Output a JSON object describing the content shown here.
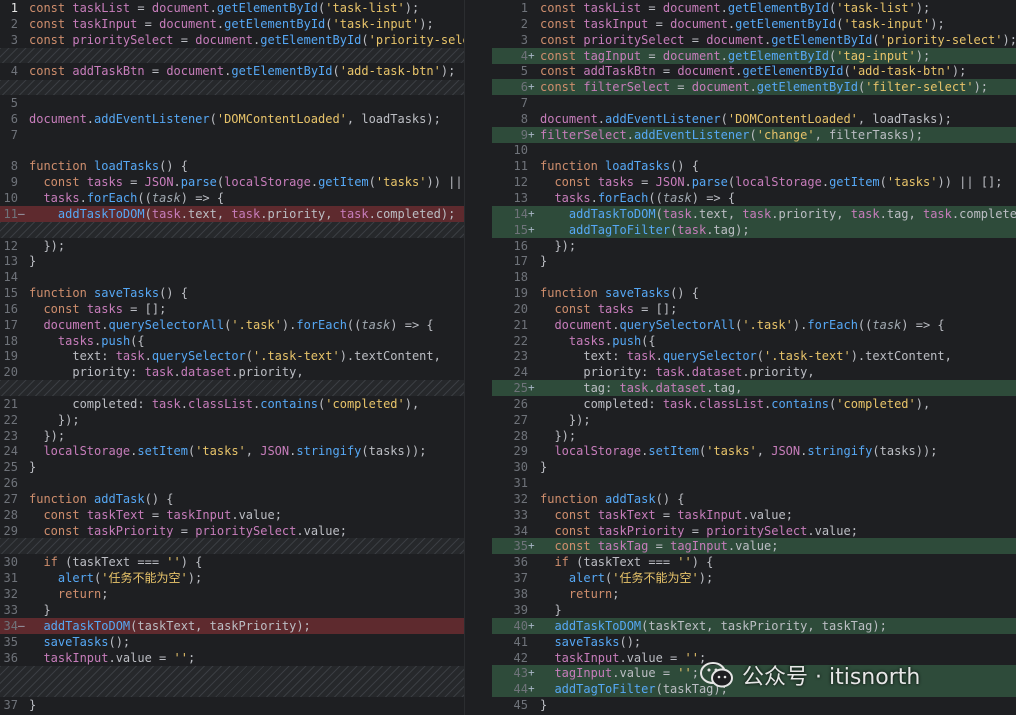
{
  "left": {
    "lines": [
      {
        "n": "1",
        "mark": "",
        "type": "cur",
        "html": "<span class=\"k\">const</span> <span class=\"v\">taskList</span> <span class=\"o\">=</span> <span class=\"v\">document</span>.<span class=\"f\">getElementById</span>(<span class=\"str\">'task-list'</span>);"
      },
      {
        "n": "2",
        "mark": "",
        "type": "",
        "html": "<span class=\"k\">const</span> <span class=\"v\">taskInput</span> <span class=\"o\">=</span> <span class=\"v\">document</span>.<span class=\"f\">getElementById</span>(<span class=\"str\">'task-input'</span>);"
      },
      {
        "n": "3",
        "mark": "",
        "type": "",
        "html": "<span class=\"k\">const</span> <span class=\"v\">prioritySelect</span> <span class=\"o\">=</span> <span class=\"v\">document</span>.<span class=\"f\">getElementById</span>(<span class=\"str\">'priority-select'</span>);"
      },
      {
        "n": "4",
        "mark": "",
        "type": "",
        "html": "<span class=\"k\">const</span> <span class=\"v\">addTaskBtn</span> <span class=\"o\">=</span> <span class=\"v\">document</span>.<span class=\"f\">getElementById</span>(<span class=\"str\">'add-task-btn'</span>);"
      },
      {
        "n": "5",
        "mark": "",
        "type": "",
        "html": ""
      },
      {
        "n": "6",
        "mark": "",
        "type": "",
        "html": "<span class=\"v\">document</span>.<span class=\"f\">addEventListener</span>(<span class=\"str\">'DOMContentLoaded'</span>, loadTasks);"
      },
      {
        "n": "7",
        "mark": "",
        "type": "",
        "html": ""
      },
      {
        "n": "8",
        "mark": "",
        "type": "",
        "html": "<span class=\"k\">function</span> <span class=\"f\">loadTasks</span>() {"
      },
      {
        "n": "9",
        "mark": "",
        "type": "",
        "html": "  <span class=\"k\">const</span> <span class=\"v\">tasks</span> <span class=\"o\">=</span> <span class=\"v\">JSON</span>.<span class=\"f\">parse</span>(<span class=\"v\">localStorage</span>.<span class=\"f\">getItem</span>(<span class=\"str\">'tasks'</span>)) || [];"
      },
      {
        "n": "10",
        "mark": "",
        "type": "",
        "html": "  <span class=\"v\">tasks</span>.<span class=\"f\">forEach</span>((<span class=\"prm\">task</span>) =&gt; {"
      },
      {
        "n": "11",
        "mark": "—",
        "type": "del",
        "html": "    <span class=\"f\">addTaskToDOM</span>(<span class=\"v\">task</span>.text, <span class=\"v\">task</span>.priority, <span class=\"v\">task</span>.completed);"
      },
      {
        "n": "12",
        "mark": "",
        "type": "",
        "html": "  });"
      },
      {
        "n": "13",
        "mark": "",
        "type": "",
        "html": "}"
      },
      {
        "n": "14",
        "mark": "",
        "type": "",
        "html": ""
      },
      {
        "n": "15",
        "mark": "",
        "type": "",
        "html": "<span class=\"k\">function</span> <span class=\"f\">saveTasks</span>() {"
      },
      {
        "n": "16",
        "mark": "",
        "type": "",
        "html": "  <span class=\"k\">const</span> <span class=\"v\">tasks</span> <span class=\"o\">=</span> [];"
      },
      {
        "n": "17",
        "mark": "",
        "type": "",
        "html": "  <span class=\"v\">document</span>.<span class=\"f\">querySelectorAll</span>(<span class=\"str\">'.task'</span>).<span class=\"f\">forEach</span>((<span class=\"prm\">task</span>) =&gt; {"
      },
      {
        "n": "18",
        "mark": "",
        "type": "",
        "html": "    <span class=\"v\">tasks</span>.<span class=\"f\">push</span>({"
      },
      {
        "n": "19",
        "mark": "",
        "type": "",
        "html": "      text: <span class=\"v\">task</span>.<span class=\"f\">querySelector</span>(<span class=\"str\">'.task-text'</span>).textContent,"
      },
      {
        "n": "20",
        "mark": "",
        "type": "",
        "html": "      priority: <span class=\"v\">task</span>.<span class=\"v\">dataset</span>.priority,"
      },
      {
        "n": "21",
        "mark": "",
        "type": "",
        "html": "      completed: <span class=\"v\">task</span>.<span class=\"v\">classList</span>.<span class=\"f\">contains</span>(<span class=\"str\">'completed'</span>),"
      },
      {
        "n": "22",
        "mark": "",
        "type": "",
        "html": "    });"
      },
      {
        "n": "23",
        "mark": "",
        "type": "",
        "html": "  });"
      },
      {
        "n": "24",
        "mark": "",
        "type": "",
        "html": "  <span class=\"v\">localStorage</span>.<span class=\"f\">setItem</span>(<span class=\"str\">'tasks'</span>, <span class=\"v\">JSON</span>.<span class=\"f\">stringify</span>(tasks));"
      },
      {
        "n": "25",
        "mark": "",
        "type": "",
        "html": "}"
      },
      {
        "n": "26",
        "mark": "",
        "type": "",
        "html": ""
      },
      {
        "n": "27",
        "mark": "",
        "type": "",
        "html": "<span class=\"k\">function</span> <span class=\"f\">addTask</span>() {"
      },
      {
        "n": "28",
        "mark": "",
        "type": "",
        "html": "  <span class=\"k\">const</span> <span class=\"v\">taskText</span> <span class=\"o\">=</span> <span class=\"v\">taskInput</span>.value;"
      },
      {
        "n": "29",
        "mark": "",
        "type": "",
        "html": "  <span class=\"k\">const</span> <span class=\"v\">taskPriority</span> <span class=\"o\">=</span> <span class=\"v\">prioritySelect</span>.value;"
      },
      {
        "n": "30",
        "mark": "",
        "type": "",
        "html": "  <span class=\"k\">if</span> (taskText === <span class=\"str\">''</span>) {"
      },
      {
        "n": "31",
        "mark": "",
        "type": "",
        "html": "    <span class=\"f\">alert</span>(<span class=\"str\">'任务不能为空'</span>);"
      },
      {
        "n": "32",
        "mark": "",
        "type": "",
        "html": "    <span class=\"k\">return</span>;"
      },
      {
        "n": "33",
        "mark": "",
        "type": "",
        "html": "  }"
      },
      {
        "n": "34",
        "mark": "—",
        "type": "del",
        "html": "  <span class=\"f\">addTaskToDOM</span>(taskText, taskPriority);"
      },
      {
        "n": "35",
        "mark": "",
        "type": "",
        "html": "  <span class=\"f\">saveTasks</span>();"
      },
      {
        "n": "36",
        "mark": "",
        "type": "",
        "html": "  <span class=\"v\">taskInput</span>.value = <span class=\"str\">''</span>;"
      },
      {
        "n": "37",
        "mark": "",
        "type": "",
        "html": "}"
      }
    ]
  },
  "right": {
    "lines": [
      {
        "n": "1",
        "mark": "",
        "type": "",
        "html": "<span class=\"k\">const</span> <span class=\"v\">taskList</span> <span class=\"o\">=</span> <span class=\"v\">document</span>.<span class=\"f\">getElementById</span>(<span class=\"str\">'task-list'</span>);"
      },
      {
        "n": "2",
        "mark": "",
        "type": "",
        "html": "<span class=\"k\">const</span> <span class=\"v\">taskInput</span> <span class=\"o\">=</span> <span class=\"v\">document</span>.<span class=\"f\">getElementById</span>(<span class=\"str\">'task-input'</span>);"
      },
      {
        "n": "3",
        "mark": "",
        "type": "",
        "html": "<span class=\"k\">const</span> <span class=\"v\">prioritySelect</span> <span class=\"o\">=</span> <span class=\"v\">document</span>.<span class=\"f\">getElementById</span>(<span class=\"str\">'priority-select'</span>);"
      },
      {
        "n": "4",
        "mark": "+",
        "type": "add",
        "html": "<span class=\"k\">const</span> <span class=\"v\">tagInput</span> <span class=\"o\">=</span> <span class=\"v\">document</span>.<span class=\"f\">getElementById</span>(<span class=\"str\">'tag-input'</span>);"
      },
      {
        "n": "5",
        "mark": "",
        "type": "",
        "html": "<span class=\"k\">const</span> <span class=\"v\">addTaskBtn</span> <span class=\"o\">=</span> <span class=\"v\">document</span>.<span class=\"f\">getElementById</span>(<span class=\"str\">'add-task-btn'</span>);"
      },
      {
        "n": "6",
        "mark": "+",
        "type": "add",
        "html": "<span class=\"k\">const</span> <span class=\"v\">filterSelect</span> <span class=\"o\">=</span> <span class=\"v\">document</span>.<span class=\"f\">getElementById</span>(<span class=\"str\">'filter-select'</span>);"
      },
      {
        "n": "7",
        "mark": "",
        "type": "",
        "html": ""
      },
      {
        "n": "8",
        "mark": "",
        "type": "",
        "html": "<span class=\"v\">document</span>.<span class=\"f\">addEventListener</span>(<span class=\"str\">'DOMContentLoaded'</span>, loadTasks);"
      },
      {
        "n": "9",
        "mark": "+",
        "type": "add",
        "html": "<span class=\"v\">filterSelect</span>.<span class=\"f\">addEventListener</span>(<span class=\"str\">'change'</span>, filterTasks);"
      },
      {
        "n": "10",
        "mark": "",
        "type": "",
        "html": ""
      },
      {
        "n": "11",
        "mark": "",
        "type": "",
        "html": "<span class=\"k\">function</span> <span class=\"f\">loadTasks</span>() {"
      },
      {
        "n": "12",
        "mark": "",
        "type": "",
        "html": "  <span class=\"k\">const</span> <span class=\"v\">tasks</span> <span class=\"o\">=</span> <span class=\"v\">JSON</span>.<span class=\"f\">parse</span>(<span class=\"v\">localStorage</span>.<span class=\"f\">getItem</span>(<span class=\"str\">'tasks'</span>)) || [];"
      },
      {
        "n": "13",
        "mark": "",
        "type": "",
        "html": "  <span class=\"v\">tasks</span>.<span class=\"f\">forEach</span>((<span class=\"prm\">task</span>) =&gt; {"
      },
      {
        "n": "14",
        "mark": "+",
        "type": "add",
        "html": "    <span class=\"f\">addTaskToDOM</span>(<span class=\"v\">task</span>.text, <span class=\"v\">task</span>.priority, <span class=\"v\">task</span>.tag, <span class=\"v\">task</span>.completed);"
      },
      {
        "n": "15",
        "mark": "+",
        "type": "add",
        "html": "    <span class=\"f\">addTagToFilter</span>(<span class=\"v\">task</span>.tag);"
      },
      {
        "n": "16",
        "mark": "",
        "type": "",
        "html": "  });"
      },
      {
        "n": "17",
        "mark": "",
        "type": "",
        "html": "}"
      },
      {
        "n": "18",
        "mark": "",
        "type": "",
        "html": ""
      },
      {
        "n": "19",
        "mark": "",
        "type": "",
        "html": "<span class=\"k\">function</span> <span class=\"f\">saveTasks</span>() {"
      },
      {
        "n": "20",
        "mark": "",
        "type": "",
        "html": "  <span class=\"k\">const</span> <span class=\"v\">tasks</span> <span class=\"o\">=</span> [];"
      },
      {
        "n": "21",
        "mark": "",
        "type": "",
        "html": "  <span class=\"v\">document</span>.<span class=\"f\">querySelectorAll</span>(<span class=\"str\">'.task'</span>).<span class=\"f\">forEach</span>((<span class=\"prm\">task</span>) =&gt; {"
      },
      {
        "n": "22",
        "mark": "",
        "type": "",
        "html": "    <span class=\"v\">tasks</span>.<span class=\"f\">push</span>({"
      },
      {
        "n": "23",
        "mark": "",
        "type": "",
        "html": "      text: <span class=\"v\">task</span>.<span class=\"f\">querySelector</span>(<span class=\"str\">'.task-text'</span>).textContent,"
      },
      {
        "n": "24",
        "mark": "",
        "type": "",
        "html": "      priority: <span class=\"v\">task</span>.<span class=\"v\">dataset</span>.priority,"
      },
      {
        "n": "25",
        "mark": "+",
        "type": "add",
        "html": "      tag: <span class=\"v\">task</span>.<span class=\"v\">dataset</span>.tag,"
      },
      {
        "n": "26",
        "mark": "",
        "type": "",
        "html": "      completed: <span class=\"v\">task</span>.<span class=\"v\">classList</span>.<span class=\"f\">contains</span>(<span class=\"str\">'completed'</span>),"
      },
      {
        "n": "27",
        "mark": "",
        "type": "",
        "html": "    });"
      },
      {
        "n": "28",
        "mark": "",
        "type": "",
        "html": "  });"
      },
      {
        "n": "29",
        "mark": "",
        "type": "",
        "html": "  <span class=\"v\">localStorage</span>.<span class=\"f\">setItem</span>(<span class=\"str\">'tasks'</span>, <span class=\"v\">JSON</span>.<span class=\"f\">stringify</span>(tasks));"
      },
      {
        "n": "30",
        "mark": "",
        "type": "",
        "html": "}"
      },
      {
        "n": "31",
        "mark": "",
        "type": "",
        "html": ""
      },
      {
        "n": "32",
        "mark": "",
        "type": "",
        "html": "<span class=\"k\">function</span> <span class=\"f\">addTask</span>() {"
      },
      {
        "n": "33",
        "mark": "",
        "type": "",
        "html": "  <span class=\"k\">const</span> <span class=\"v\">taskText</span> <span class=\"o\">=</span> <span class=\"v\">taskInput</span>.value;"
      },
      {
        "n": "34",
        "mark": "",
        "type": "",
        "html": "  <span class=\"k\">const</span> <span class=\"v\">taskPriority</span> <span class=\"o\">=</span> <span class=\"v\">prioritySelect</span>.value;"
      },
      {
        "n": "35",
        "mark": "+",
        "type": "add",
        "html": "  <span class=\"k\">const</span> <span class=\"v\">taskTag</span> <span class=\"o\">=</span> <span class=\"v\">tagInput</span>.value;"
      },
      {
        "n": "36",
        "mark": "",
        "type": "",
        "html": "  <span class=\"k\">if</span> (taskText === <span class=\"str\">''</span>) {"
      },
      {
        "n": "37",
        "mark": "",
        "type": "",
        "html": "    <span class=\"f\">alert</span>(<span class=\"str\">'任务不能为空'</span>);"
      },
      {
        "n": "38",
        "mark": "",
        "type": "",
        "html": "    <span class=\"k\">return</span>;"
      },
      {
        "n": "39",
        "mark": "",
        "type": "",
        "html": "  }"
      },
      {
        "n": "40",
        "mark": "+",
        "type": "add",
        "html": "  <span class=\"f\">addTaskToDOM</span>(taskText, taskPriority, taskTag);"
      },
      {
        "n": "41",
        "mark": "",
        "type": "",
        "html": "  <span class=\"f\">saveTasks</span>();"
      },
      {
        "n": "42",
        "mark": "",
        "type": "",
        "html": "  <span class=\"v\">taskInput</span>.value = <span class=\"str\">''</span>;"
      },
      {
        "n": "43",
        "mark": "+",
        "type": "add",
        "html": "  <span class=\"v\">tagInput</span>.value = <span class=\"str\">''</span>;"
      },
      {
        "n": "44",
        "mark": "+",
        "type": "add",
        "html": "  <span class=\"f\">addTagToFilter</span>(taskTag);"
      },
      {
        "n": "45",
        "mark": "",
        "type": "",
        "html": "}"
      }
    ]
  },
  "watermark": {
    "text": "公众号 · itisnorth",
    "icon": "wechat-icon"
  }
}
